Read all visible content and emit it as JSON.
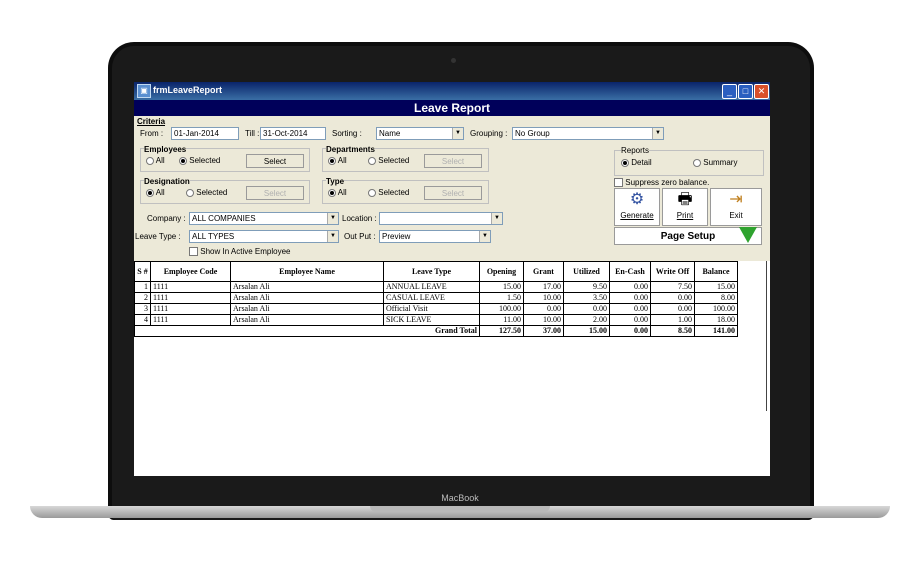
{
  "window": {
    "title": "frmLeaveReport",
    "header": "Leave Report"
  },
  "criteria": {
    "label": "Criteria",
    "from_label": "From :",
    "from_value": "01-Jan-2014",
    "till_label": "Till :",
    "till_value": "31-Oct-2014",
    "sorting_label": "Sorting :",
    "sorting_value": "Name",
    "grouping_label": "Grouping :",
    "grouping_value": "No Group",
    "employees": {
      "label": "Employees",
      "all": "All",
      "selected": "Selected",
      "select_btn": "Select",
      "state": "selected"
    },
    "designation": {
      "label": "Designation",
      "all": "All",
      "selected": "Selected",
      "select_btn": "Select",
      "state": "all"
    },
    "departments": {
      "label": "Departments",
      "all": "All",
      "selected": "Selected",
      "select_btn": "Select",
      "state": "all"
    },
    "type": {
      "label": "Type",
      "all": "All",
      "selected": "Selected",
      "select_btn": "Select",
      "state": "all"
    },
    "company_label": "Company :",
    "company_value": "ALL COMPANIES",
    "location_label": "Location :",
    "location_value": "",
    "leave_type_label": "Leave Type :",
    "leave_type_value": "ALL TYPES",
    "output_label": "Out Put :",
    "output_value": "Preview",
    "show_inactive": "Show In Active Employee"
  },
  "reports": {
    "label": "Reports",
    "detail": "Detail",
    "summary": "Summary",
    "state": "detail",
    "suppress": "Suppress zero balance."
  },
  "actions": {
    "generate": "Generate",
    "print": "Print",
    "exit": "Exit",
    "page_setup": "Page Setup"
  },
  "table": {
    "headers": [
      "S #",
      "Employee Code",
      "Employee Name",
      "Leave Type",
      "Opening",
      "Grant",
      "Utilized",
      "En-Cash",
      "Write Off",
      "Balance"
    ],
    "rows": [
      [
        "1",
        "1111",
        "Arsalan Ali",
        "ANNUAL LEAVE",
        "15.00",
        "17.00",
        "9.50",
        "0.00",
        "7.50",
        "15.00"
      ],
      [
        "2",
        "1111",
        "Arsalan Ali",
        "CASUAL LEAVE",
        "1.50",
        "10.00",
        "3.50",
        "0.00",
        "0.00",
        "8.00"
      ],
      [
        "3",
        "1111",
        "Arsalan Ali",
        "Official Visit",
        "100.00",
        "0.00",
        "0.00",
        "0.00",
        "0.00",
        "100.00"
      ],
      [
        "4",
        "1111",
        "Arsalan Ali",
        "SICK LEAVE",
        "11.00",
        "10.00",
        "2.00",
        "0.00",
        "1.00",
        "18.00"
      ]
    ],
    "total_label": "Grand Total",
    "totals": [
      "127.50",
      "37.00",
      "15.00",
      "0.00",
      "8.50",
      "141.00"
    ]
  },
  "laptop_brand": "MacBook"
}
